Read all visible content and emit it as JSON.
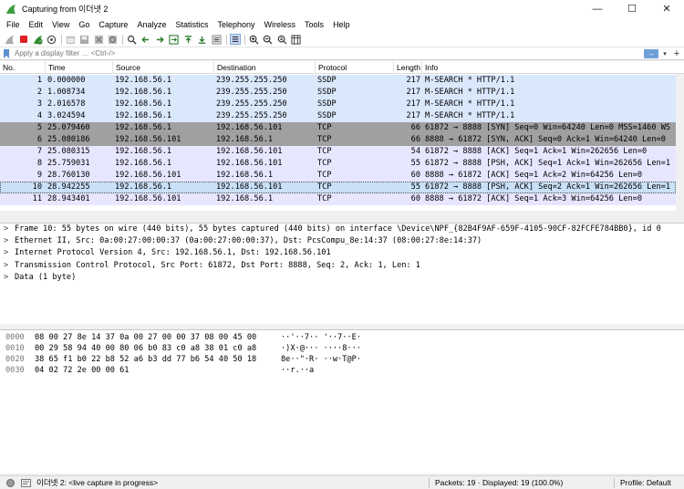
{
  "window": {
    "title": "Capturing from 이더넷 2",
    "minimize": "—",
    "maximize": "☐",
    "close": "✕"
  },
  "menu": [
    "File",
    "Edit",
    "View",
    "Go",
    "Capture",
    "Analyze",
    "Statistics",
    "Telephony",
    "Wireless",
    "Tools",
    "Help"
  ],
  "filter": {
    "placeholder": "Apply a display filter … <Ctrl-/>",
    "apply": "→",
    "dropdown": "▾",
    "add": "+"
  },
  "columns": [
    "No.",
    "Time",
    "Source",
    "Destination",
    "Protocol",
    "Length",
    "Info"
  ],
  "packets": [
    {
      "no": "1",
      "time": "0.000000",
      "src": "192.168.56.1",
      "dst": "239.255.255.250",
      "proto": "SSDP",
      "len": "217",
      "info": "M-SEARCH * HTTP/1.1",
      "style": "ssdp"
    },
    {
      "no": "2",
      "time": "1.008734",
      "src": "192.168.56.1",
      "dst": "239.255.255.250",
      "proto": "SSDP",
      "len": "217",
      "info": "M-SEARCH * HTTP/1.1",
      "style": "ssdp"
    },
    {
      "no": "3",
      "time": "2.016578",
      "src": "192.168.56.1",
      "dst": "239.255.255.250",
      "proto": "SSDP",
      "len": "217",
      "info": "M-SEARCH * HTTP/1.1",
      "style": "ssdp"
    },
    {
      "no": "4",
      "time": "3.024594",
      "src": "192.168.56.1",
      "dst": "239.255.255.250",
      "proto": "SSDP",
      "len": "217",
      "info": "M-SEARCH * HTTP/1.1",
      "style": "ssdp"
    },
    {
      "no": "5",
      "time": "25.079460",
      "src": "192.168.56.1",
      "dst": "192.168.56.101",
      "proto": "TCP",
      "len": "66",
      "info": "61872 → 8888 [SYN] Seq=0 Win=64240 Len=0 MSS=1460 WS",
      "style": "syn"
    },
    {
      "no": "6",
      "time": "25.080186",
      "src": "192.168.56.101",
      "dst": "192.168.56.1",
      "proto": "TCP",
      "len": "66",
      "info": "8888 → 61872 [SYN, ACK] Seq=0 Ack=1 Win=64240 Len=0",
      "style": "syn"
    },
    {
      "no": "7",
      "time": "25.080315",
      "src": "192.168.56.1",
      "dst": "192.168.56.101",
      "proto": "TCP",
      "len": "54",
      "info": "61872 → 8888 [ACK] Seq=1 Ack=1 Win=262656 Len=0",
      "style": "tcp"
    },
    {
      "no": "8",
      "time": "25.759031",
      "src": "192.168.56.1",
      "dst": "192.168.56.101",
      "proto": "TCP",
      "len": "55",
      "info": "61872 → 8888 [PSH, ACK] Seq=1 Ack=1 Win=262656 Len=1",
      "style": "tcp"
    },
    {
      "no": "9",
      "time": "28.760130",
      "src": "192.168.56.101",
      "dst": "192.168.56.1",
      "proto": "TCP",
      "len": "60",
      "info": "8888 → 61872 [ACK] Seq=1 Ack=2 Win=64256 Len=0",
      "style": "tcp"
    },
    {
      "no": "10",
      "time": "28.942255",
      "src": "192.168.56.1",
      "dst": "192.168.56.101",
      "proto": "TCP",
      "len": "55",
      "info": "61872 → 8888 [PSH, ACK] Seq=2 Ack=1 Win=262656 Len=1",
      "style": "selected"
    },
    {
      "no": "11",
      "time": "28.943401",
      "src": "192.168.56.101",
      "dst": "192.168.56.1",
      "proto": "TCP",
      "len": "60",
      "info": "8888 → 61872 [ACK] Seq=1 Ack=3 Win=64256 Len=0",
      "style": "tcp"
    }
  ],
  "details": [
    "Frame 10: 55 bytes on wire (440 bits), 55 bytes captured (440 bits) on interface \\Device\\NPF_{82B4F9AF-659F-4105-90CF-82FCFE784BB0}, id 0",
    "Ethernet II, Src: 0a:00:27:00:00:37 (0a:00:27:00:00:37), Dst: PcsCompu_8e:14:37 (08:00:27:8e:14:37)",
    "Internet Protocol Version 4, Src: 192.168.56.1, Dst: 192.168.56.101",
    "Transmission Control Protocol, Src Port: 61872, Dst Port: 8888, Seq: 2, Ack: 1, Len: 1",
    "Data (1 byte)"
  ],
  "bytes": [
    {
      "offset": "0000",
      "hex": "08 00 27 8e 14 37 0a 00  27 00 00 37 08 00 45 00",
      "ascii": "··'··7·· '··7··E·"
    },
    {
      "offset": "0010",
      "hex": "00 29 58 94 40 00 80 06  b0 83 c0 a8 38 01 c0 a8",
      "ascii": "·)X·@··· ····8···"
    },
    {
      "offset": "0020",
      "hex": "38 65 f1 b0 22 b8 52 a6  b3 dd 77 b6 54 40 50 18",
      "ascii": "8e··\"·R· ··w·T@P·"
    },
    {
      "offset": "0030",
      "hex": "04 02 72 2e 00 00 61",
      "ascii": "··r.··a"
    }
  ],
  "status": {
    "interface": "이더넷 2: <live capture in progress>",
    "packets": "Packets: 19 · Displayed: 19 (100.0%)",
    "profile": "Profile: Default"
  },
  "colors": {
    "ssdp": "#dae8fc",
    "syn": "#a0a0a0",
    "tcp": "#e7e6ff",
    "selected": "#c9e0f7"
  },
  "icons": [
    "shark-fin-icon",
    "stop-icon",
    "restart-icon",
    "options-icon",
    "open-icon",
    "save-icon",
    "close-file-icon",
    "reload-icon",
    "find-icon",
    "back-icon",
    "forward-icon",
    "goto-icon",
    "first-icon",
    "last-icon",
    "autoscroll-icon",
    "colorize-icon",
    "zoom-in-icon",
    "zoom-out-icon",
    "zoom-reset-icon",
    "resize-columns-icon"
  ]
}
